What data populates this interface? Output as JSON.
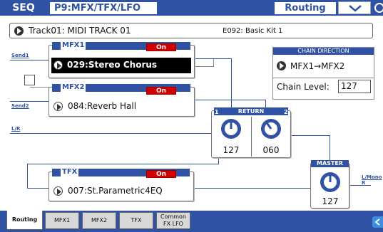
{
  "header": {
    "mode": "SEQ",
    "page_title": "P9:MFX/TFX/LFO",
    "page_label": "Routing",
    "menu_icon": "chevron-down-icon",
    "corner_icon": "partial-round-icon"
  },
  "track": {
    "name": "Track01: MIDI TRACK 01",
    "kit": "E092: Basic Kit 1"
  },
  "labels": {
    "send1": "Send1",
    "send2": "Send2",
    "lr": "L/R",
    "lmono_l": "L/Mono",
    "lmono_r": "R"
  },
  "mfx1": {
    "title": "MFX1",
    "on_label": "On",
    "effect": "029:Stereo Chorus"
  },
  "mfx2": {
    "title": "MFX2",
    "on_label": "On",
    "effect": "084:Reverb Hall"
  },
  "tfx": {
    "title": "TFX",
    "on_label": "On",
    "effect": "007:St.Parametric4EQ"
  },
  "chain": {
    "header": "CHAIN DIRECTION",
    "direction": "MFX1→MFX2",
    "level_label": "Chain Level:",
    "level_value": "127"
  },
  "return": {
    "header": "RETURN",
    "num1": "1",
    "num2": "2",
    "value1": "127",
    "value2": "060"
  },
  "master": {
    "header": "MASTER",
    "value": "127"
  },
  "tabs": [
    {
      "label": "Routing"
    },
    {
      "label": "MFX1"
    },
    {
      "label": "MFX2"
    },
    {
      "label": "TFX"
    },
    {
      "label_line1": "Common",
      "label_line2": "FX LFO"
    }
  ],
  "colors": {
    "accent": "#2f52a4",
    "on_button": "#d40000"
  }
}
